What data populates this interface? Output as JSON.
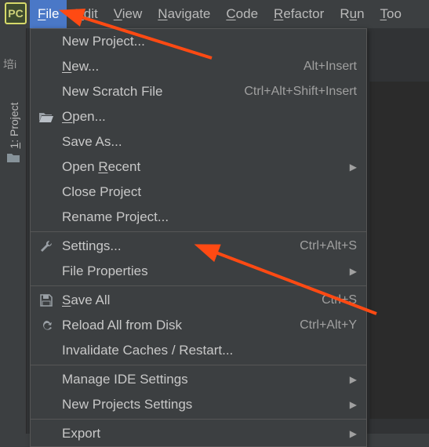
{
  "app_icon_text": "PC",
  "menubar": {
    "file": "File",
    "edit": "Edit",
    "view": "View",
    "navigate": "Navigate",
    "code": "Code",
    "refactor": "Refactor",
    "run": "Run",
    "tools": "Tools"
  },
  "sidebar": {
    "truncated": "培i",
    "project_tab": "1: Project"
  },
  "file_menu": {
    "new_project": "New Project...",
    "new": "New...",
    "new_sc": "Alt+Insert",
    "new_scratch": "New Scratch File",
    "new_scratch_sc": "Ctrl+Alt+Shift+Insert",
    "open": "Open...",
    "save_as": "Save As...",
    "open_recent": "Open Recent",
    "close_project": "Close Project",
    "rename_project": "Rename Project...",
    "settings": "Settings...",
    "settings_sc": "Ctrl+Alt+S",
    "file_properties": "File Properties",
    "save_all": "Save All",
    "save_all_sc": "Ctrl+S",
    "reload": "Reload All from Disk",
    "reload_sc": "Ctrl+Alt+Y",
    "invalidate": "Invalidate Caches / Restart...",
    "manage_ide": "Manage IDE Settings",
    "new_proj_settings": "New Projects Settings",
    "export": "Export"
  }
}
